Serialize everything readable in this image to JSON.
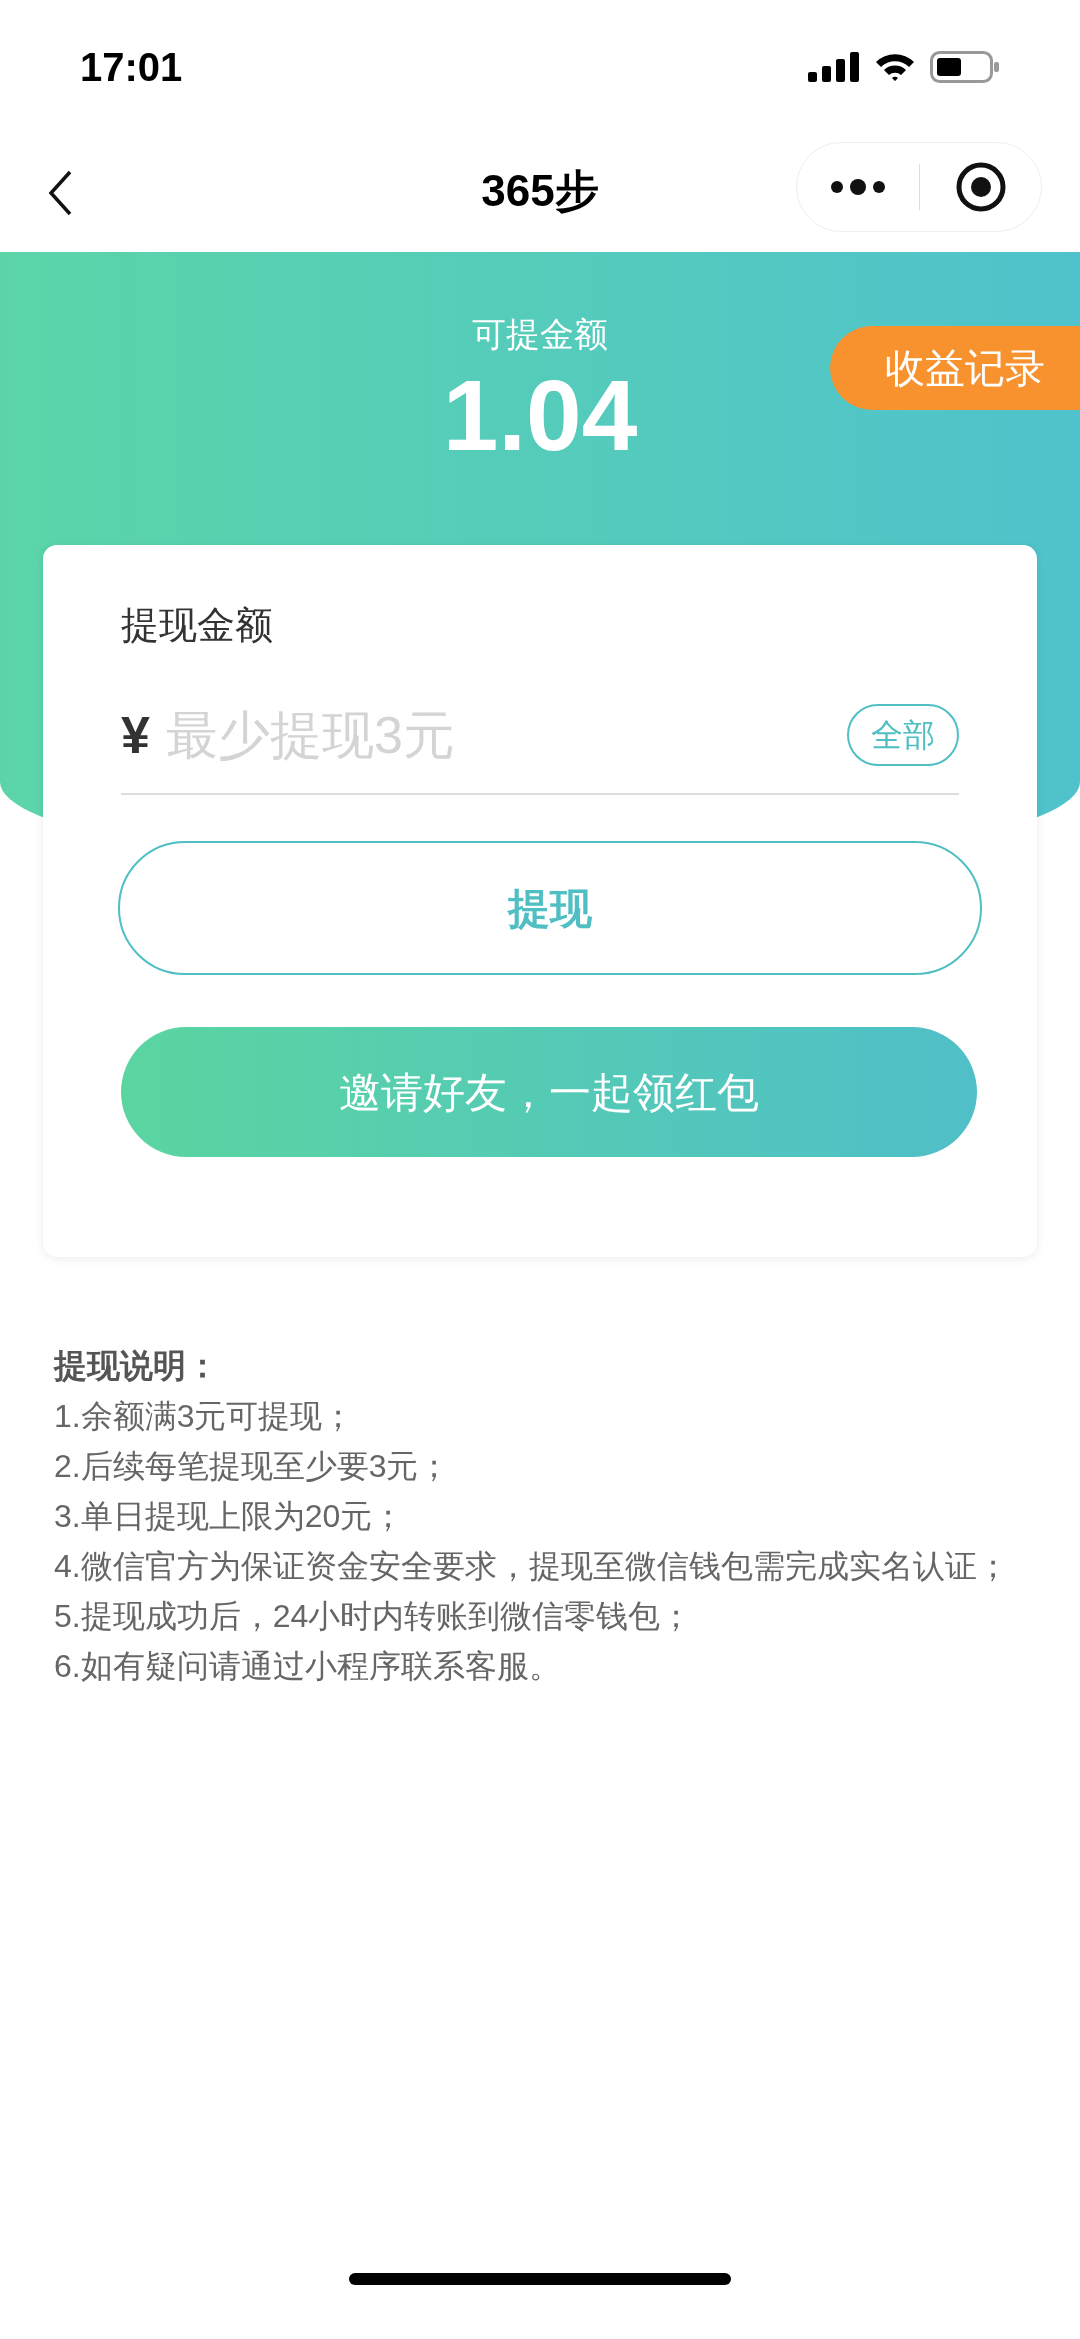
{
  "status_bar": {
    "time": "17:01"
  },
  "nav": {
    "title": "365步"
  },
  "balance": {
    "label": "可提金额",
    "amount": "1.04"
  },
  "records_button": "收益记录",
  "withdraw_card": {
    "title": "提现金额",
    "currency": "¥",
    "placeholder": "最少提现3元",
    "all_button": "全部",
    "withdraw_button": "提现",
    "invite_button": "邀请好友，一起领红包"
  },
  "notes": {
    "title": "提现说明：",
    "items": [
      "1.余额满3元可提现；",
      "2.后续每笔提现至少要3元；",
      "3.单日提现上限为20元；",
      "4.微信官方为保证资金安全要求，提现至微信钱包需完成实名认证；",
      "5.提现成功后，24小时内转账到微信零钱包；",
      "6.如有疑问请通过小程序联系客服。"
    ]
  }
}
